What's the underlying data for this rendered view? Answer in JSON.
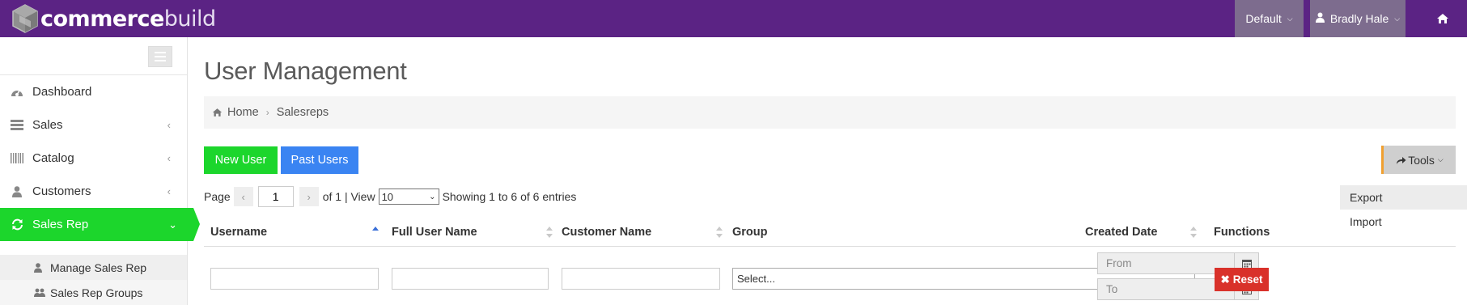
{
  "app": {
    "brand_bold": "commerce",
    "brand_light": "build",
    "store_selector": "Default",
    "user_menu": "Bradly Hale",
    "icons": {
      "home": "home-icon",
      "chevron": "chevron-down-icon"
    }
  },
  "sidebar": {
    "items": [
      {
        "label": "Dashboard",
        "icon": "dashboard-icon"
      },
      {
        "label": "Sales",
        "icon": "sales-icon",
        "arrow": "‹"
      },
      {
        "label": "Catalog",
        "icon": "barcode-icon",
        "arrow": "‹"
      },
      {
        "label": "Customers",
        "icon": "user-icon",
        "arrow": "‹"
      },
      {
        "label": "Sales Rep",
        "icon": "refresh-icon",
        "arrow": "⌄",
        "active": true
      }
    ],
    "sub_items": [
      {
        "label": "Manage Sales Rep",
        "icon": "user-icon"
      },
      {
        "label": "Sales Rep Groups",
        "icon": "users-icon"
      }
    ],
    "active_color": "#1cd62c"
  },
  "main": {
    "title": "User Management",
    "breadcrumb": {
      "home": "Home",
      "current": "Salesreps"
    },
    "buttons": {
      "new_user": "New User",
      "past_users": "Past Users",
      "tools": "Tools"
    },
    "tools_menu": [
      "Export",
      "Import"
    ],
    "pager": {
      "page_label": "Page",
      "page_value": "1",
      "of_label": "of 1 | View",
      "view_value": "10",
      "showing": "Showing 1 to 6 of 6 entries"
    },
    "table": {
      "columns": [
        "Username",
        "Full User Name",
        "Customer Name",
        "Group",
        "Created Date",
        "Functions"
      ],
      "sorted_column": "Username",
      "sort_direction": "asc"
    },
    "filters": {
      "group_placeholder": "Select...",
      "date_from": "From",
      "date_to": "To",
      "reset": "Reset"
    }
  },
  "colors": {
    "topbar": "#5b2384",
    "success": "#1cd62c",
    "primary": "#3a84f2",
    "danger": "#d9312a"
  }
}
